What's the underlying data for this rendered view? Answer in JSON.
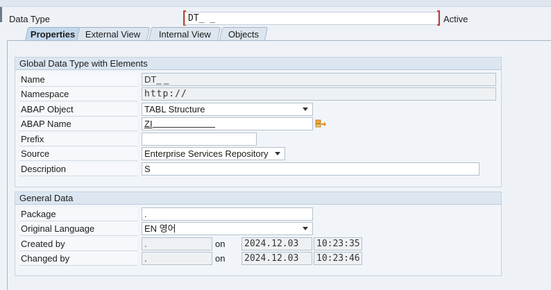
{
  "header": {
    "label": "Data Type",
    "name_value": "DT_                _",
    "status": "Active"
  },
  "tabs": [
    {
      "label": "Properties",
      "active": true
    },
    {
      "label": "External View",
      "active": false
    },
    {
      "label": "Internal View",
      "active": false
    },
    {
      "label": "Objects",
      "active": false
    }
  ],
  "global": {
    "title": "Global Data Type with Elements",
    "fields": {
      "name": {
        "label": "Name",
        "value": "DT_              _"
      },
      "namespace": {
        "label": "Namespace",
        "value": "http://"
      },
      "abap_object": {
        "label": "ABAP Object",
        "value": "TABL Structure"
      },
      "abap_name": {
        "label": "ABAP Name",
        "value": "ZI"
      },
      "prefix": {
        "label": "Prefix",
        "value": ""
      },
      "source": {
        "label": "Source",
        "value": "Enterprise Services Repository"
      },
      "description": {
        "label": "Description",
        "value": "S"
      }
    }
  },
  "general": {
    "title": "General Data",
    "fields": {
      "package": {
        "label": "Package",
        "value": "."
      },
      "language": {
        "label": "Original Language",
        "value": "EN 영어"
      },
      "created": {
        "label": "Created by",
        "user": ".",
        "on": "on",
        "date": "2024.12.03",
        "time": "10:23:35"
      },
      "changed": {
        "label": "Changed by",
        "user": ".",
        "on": "on",
        "date": "2024.12.03",
        "time": "10:23:46"
      }
    }
  },
  "icons": {
    "navigate": "navigate-arrow-icon"
  }
}
